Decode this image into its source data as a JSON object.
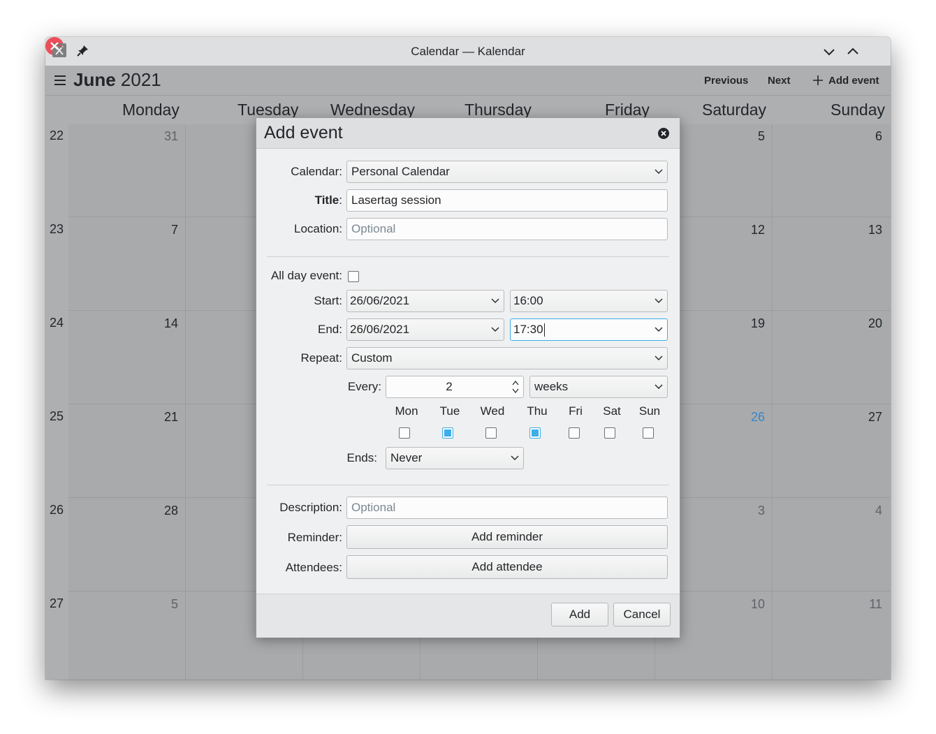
{
  "window": {
    "title": "Calendar — Kalendar"
  },
  "toolbar": {
    "month": "June",
    "year": "2021",
    "previous_label": "Previous",
    "next_label": "Next",
    "add_event_label": "Add event"
  },
  "calendar": {
    "day_headers": [
      "Monday",
      "Tuesday",
      "Wednesday",
      "Thursday",
      "Friday",
      "Saturday",
      "Sunday"
    ],
    "weeks": [
      {
        "week": "22",
        "mon": "31",
        "sat": "5",
        "sun": "6"
      },
      {
        "week": "23",
        "mon": "7",
        "sat": "12",
        "sun": "13"
      },
      {
        "week": "24",
        "mon": "14",
        "sat": "19",
        "sun": "20"
      },
      {
        "week": "25",
        "mon": "21",
        "sat": "26",
        "sun": "27"
      },
      {
        "week": "26",
        "mon": "28",
        "sat": "3",
        "sun": "4"
      },
      {
        "week": "27",
        "mon": "5",
        "sat": "10",
        "sun": "11"
      }
    ],
    "today_color": "#3a87c8"
  },
  "dialog": {
    "title": "Add event",
    "calendar_label": "Calendar:",
    "calendar_value": "Personal Calendar",
    "title_label": "Title",
    "title_colon": ":",
    "title_value": "Lasertag session",
    "location_label": "Location:",
    "location_placeholder": "Optional",
    "all_day_label": "All day event:",
    "all_day_checked": false,
    "start_label": "Start:",
    "start_date": "26/06/2021",
    "start_time": "16:00",
    "end_label": "End:",
    "end_date": "26/06/2021",
    "end_time": "17:30",
    "repeat_label": "Repeat:",
    "repeat_value": "Custom",
    "every_label": "Every:",
    "every_value": "2",
    "every_unit": "weeks",
    "weekdays": [
      {
        "label": "Mon",
        "checked": false
      },
      {
        "label": "Tue",
        "checked": true
      },
      {
        "label": "Wed",
        "checked": false
      },
      {
        "label": "Thu",
        "checked": true
      },
      {
        "label": "Fri",
        "checked": false
      },
      {
        "label": "Sat",
        "checked": false
      },
      {
        "label": "Sun",
        "checked": false
      }
    ],
    "ends_label": "Ends:",
    "ends_value": "Never",
    "description_label": "Description:",
    "description_placeholder": "Optional",
    "reminder_label": "Reminder:",
    "add_reminder_label": "Add reminder",
    "attendees_label": "Attendees:",
    "add_attendee_label": "Add attendee",
    "add_button": "Add",
    "cancel_button": "Cancel"
  },
  "colors": {
    "accent": "#3daee9",
    "close": "#ed4d5a",
    "background": "#aeafb1"
  }
}
